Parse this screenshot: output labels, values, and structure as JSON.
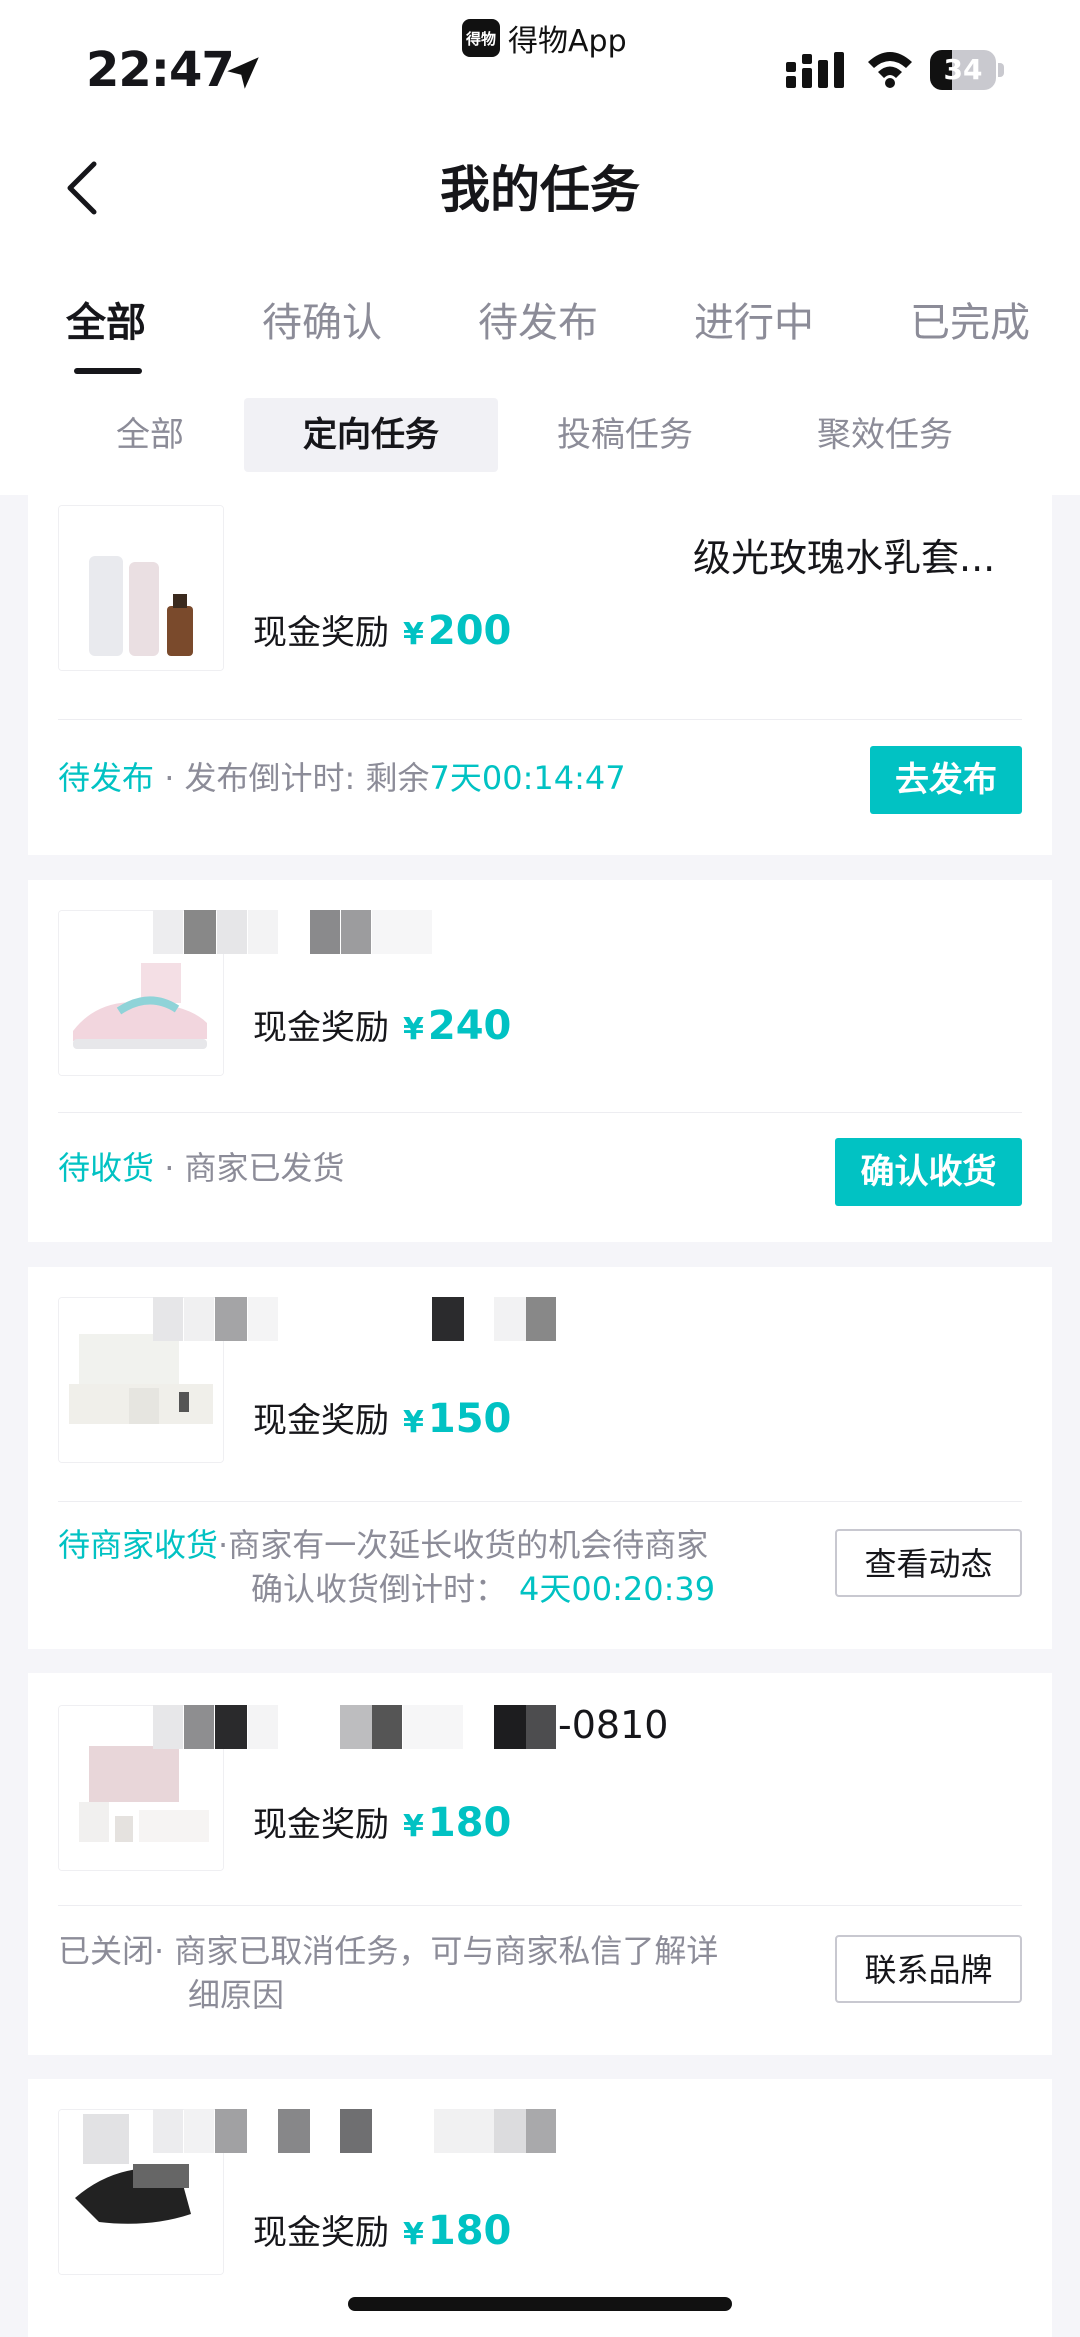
{
  "status_bar": {
    "time": "22:47",
    "app_badge": "得物App",
    "app_logo": "得物",
    "battery": "34",
    "battery_level": 0.34
  },
  "header": {
    "title": "我的任务",
    "back_icon": "chevron-left-icon"
  },
  "tabs": [
    {
      "label": "全部",
      "active": true
    },
    {
      "label": "待确认",
      "active": false
    },
    {
      "label": "待发布",
      "active": false
    },
    {
      "label": "进行中",
      "active": false
    },
    {
      "label": "已完成",
      "active": false
    }
  ],
  "subtabs": [
    {
      "label": "全部",
      "active": false
    },
    {
      "label": "定向任务",
      "active": true
    },
    {
      "label": "投稿任务",
      "active": false
    },
    {
      "label": "聚效任务",
      "active": false
    }
  ],
  "tasks": [
    {
      "title": "级光玫瑰水乳套...",
      "reward_label": "现金奖励",
      "currency": "¥",
      "amount": "200",
      "status": "待发布",
      "detail": "· 发布倒计时: 剩余",
      "highlight": "7天00:14:47",
      "button": "去发布"
    },
    {
      "title": "",
      "reward_label": "现金奖励",
      "currency": "¥",
      "amount": "240",
      "status": "待收货",
      "detail": "· 商家已发货",
      "button": "确认收货"
    },
    {
      "title": "",
      "reward_label": "现金奖励",
      "currency": "¥",
      "amount": "150",
      "status": "待商家收货",
      "detail_line1": "·商家有一次延长收货的机会待商家",
      "detail_line2": "确认收货倒计时：",
      "highlight": "4天00:20:39",
      "button": "查看动态"
    },
    {
      "title": "-0810",
      "reward_label": "现金奖励",
      "currency": "¥",
      "amount": "180",
      "status": "已关闭",
      "detail_line1": "· 商家已取消任务，可与商家私信了解详",
      "detail_line2": "细原因",
      "button": "联系品牌"
    },
    {
      "title": "",
      "reward_label": "现金奖励",
      "currency": "¥",
      "amount": "180"
    }
  ]
}
